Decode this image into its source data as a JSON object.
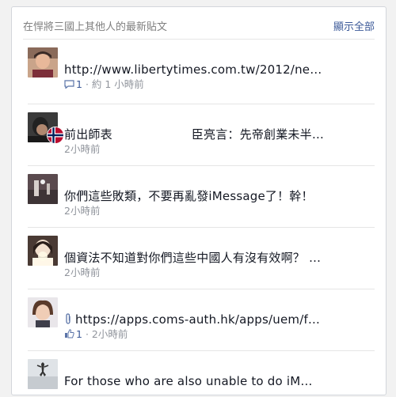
{
  "panel": {
    "title": "在悍將三國上其他人的最新貼文",
    "show_all": "顯示全部"
  },
  "posts": [
    {
      "text": "http://www.libertytimes.com.tw/2012/ne…",
      "count": "1",
      "time": "約 1 小時前",
      "count_icon": "comment-icon"
    },
    {
      "text_a": "前出師表",
      "text_b": "臣亮言：先帝創業未半…",
      "time": "2小時前"
    },
    {
      "text": "你們這些敗類，不要再亂發iMessage了！幹！",
      "time": "2小時前"
    },
    {
      "text": "個資法不知道對你們這些中國人有沒有效啊？ …",
      "time": "2小時前"
    },
    {
      "text": "https://apps.coms-auth.hk/apps/uem/f…",
      "count": "1",
      "time": "2小時前",
      "count_icon": "like-icon",
      "attach_icon": "paperclip-icon"
    },
    {
      "text": "For those who are also unable to do iM…"
    }
  ],
  "colors": {
    "link": "#3b5998",
    "text": "#141823",
    "meta": "#90949c",
    "border": "#d3d6db"
  }
}
